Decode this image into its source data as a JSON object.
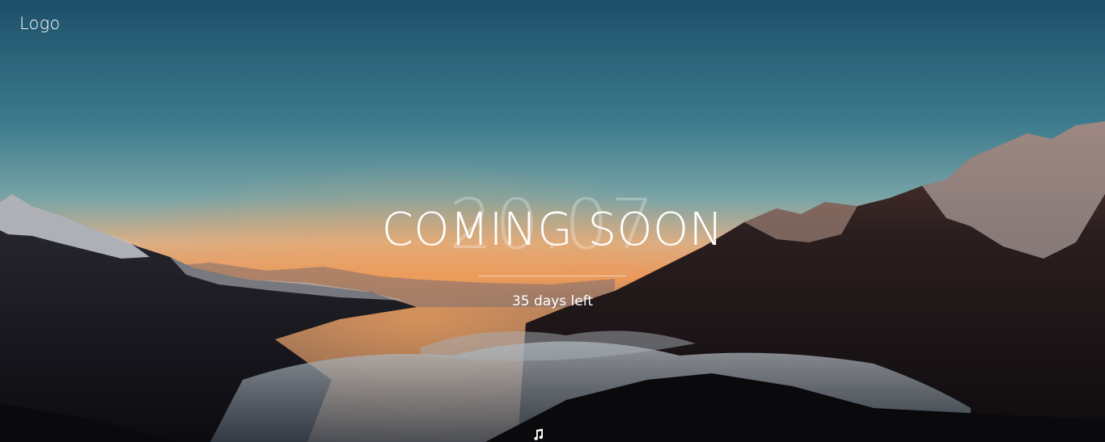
{
  "header": {
    "logo_text": "Logo"
  },
  "hero": {
    "date_text": "20.07",
    "title": "COMING SOON",
    "countdown_text": "35 days left"
  },
  "controls": {
    "music_icon": "music-note-icon"
  },
  "colors": {
    "sky_top": "#1f5670",
    "sky_mid": "#3e7f93",
    "horizon_glow": "#e99a5a",
    "mountain_dark": "#120f12",
    "text": "#ffffff"
  }
}
